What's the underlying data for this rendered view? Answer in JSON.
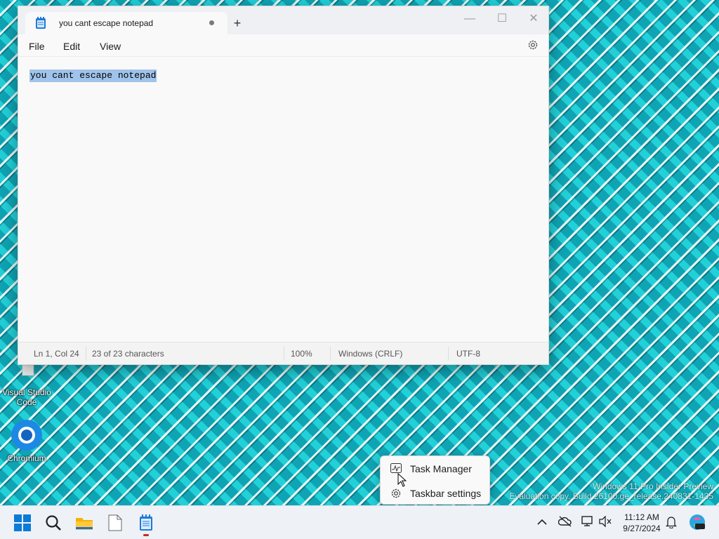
{
  "desktop": {
    "icons": [
      {
        "label": "Visual Studio Code"
      },
      {
        "label": "Chromium"
      }
    ],
    "watermark": {
      "line1": "Windows 11 Pro Insider Preview",
      "line2": "Evaluation copy. Build 26100.ge_release.240831-1435"
    }
  },
  "notepad": {
    "tab_title": "you cant escape notepad",
    "new_tab_symbol": "+",
    "controls": {
      "minimize": "—",
      "maximize": "☐",
      "close": "✕"
    },
    "menu": {
      "file": "File",
      "edit": "Edit",
      "view": "View"
    },
    "content": "you cant escape notepad",
    "status": {
      "position": "Ln 1, Col 24",
      "characters": "23 of 23 characters",
      "zoom": "100%",
      "line_ending": "Windows (CRLF)",
      "encoding": "UTF-8"
    }
  },
  "context_menu": {
    "items": [
      {
        "label": "Task Manager",
        "icon": "task-manager-icon"
      },
      {
        "label": "Taskbar settings",
        "icon": "gear-icon"
      }
    ]
  },
  "taskbar": {
    "apps": [
      "start",
      "search",
      "file-explorer",
      "blank-file",
      "notepad"
    ],
    "clock": {
      "time": "11:12 AM",
      "date": "9/27/2024"
    }
  },
  "colors": {
    "accent": "#0078d4",
    "selection": "#9fc3ea",
    "close_red": "#c42b1c"
  }
}
